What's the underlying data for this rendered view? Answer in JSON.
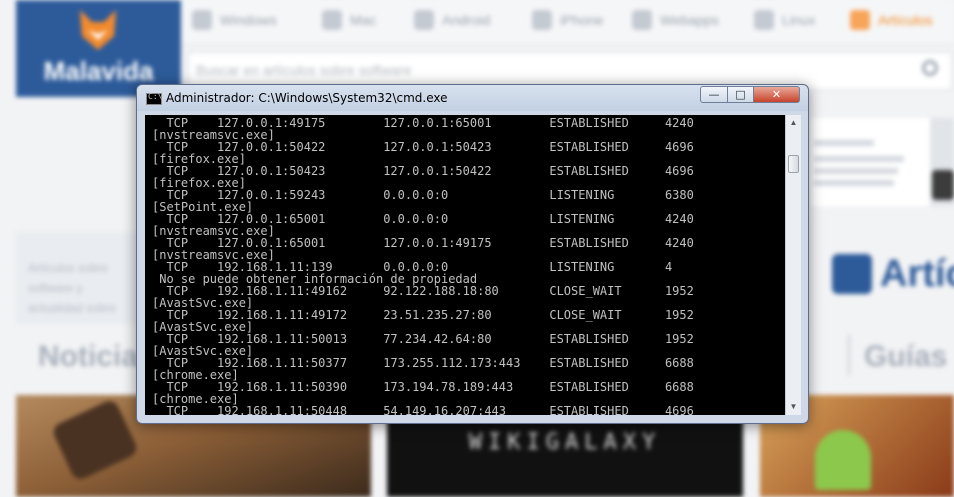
{
  "background": {
    "logo_text": "Malavida",
    "nav": [
      "Windows",
      "Mac",
      "Android",
      "iPhone",
      "Webapps",
      "Linux",
      "Artículos"
    ],
    "search_placeholder": "Buscar en artículos sobre software",
    "strip_text": "Artículos sobre software y actualidad sobre",
    "noticias": "Noticias",
    "guias": "Guías",
    "articles_heading": "Artíc",
    "photo_text": "WIKIGALAXY"
  },
  "window": {
    "title": "Administrador: C:\\Windows\\System32\\cmd.exe",
    "icon_label": "C:\\",
    "controls": {
      "minimize": "—",
      "maximize": "□",
      "close": "✕"
    }
  },
  "console_lines": [
    "  TCP    127.0.0.1:49175        127.0.0.1:65001        ESTABLISHED     4240",
    "[nvstreamsvc.exe]",
    "  TCP    127.0.0.1:50422        127.0.0.1:50423        ESTABLISHED     4696",
    "[firefox.exe]",
    "  TCP    127.0.0.1:50423        127.0.0.1:50422        ESTABLISHED     4696",
    "[firefox.exe]",
    "  TCP    127.0.0.1:59243        0.0.0.0:0              LISTENING       6380",
    "[SetPoint.exe]",
    "  TCP    127.0.0.1:65001        0.0.0.0:0              LISTENING       4240",
    "[nvstreamsvc.exe]",
    "  TCP    127.0.0.1:65001        127.0.0.1:49175        ESTABLISHED     4240",
    "[nvstreamsvc.exe]",
    "  TCP    192.168.1.11:139       0.0.0.0:0              LISTENING       4",
    " No se puede obtener información de propiedad",
    "  TCP    192.168.1.11:49162     92.122.188.18:80       CLOSE_WAIT      1952",
    "[AvastSvc.exe]",
    "  TCP    192.168.1.11:49172     23.51.235.27:80        CLOSE_WAIT      1952",
    "[AvastSvc.exe]",
    "  TCP    192.168.1.11:50013     77.234.42.64:80        ESTABLISHED     1952",
    "[AvastSvc.exe]",
    "  TCP    192.168.1.11:50377     173.255.112.173:443    ESTABLISHED     6688",
    "[chrome.exe]",
    "  TCP    192.168.1.11:50390     173.194.78.189:443     ESTABLISHED     6688",
    "[chrome.exe]",
    "  TCP    192.168.1.11:50448     54.149.16.207:443      ESTABLISHED     4696"
  ],
  "scrollbar": {
    "up": "▲",
    "down": "▼"
  }
}
